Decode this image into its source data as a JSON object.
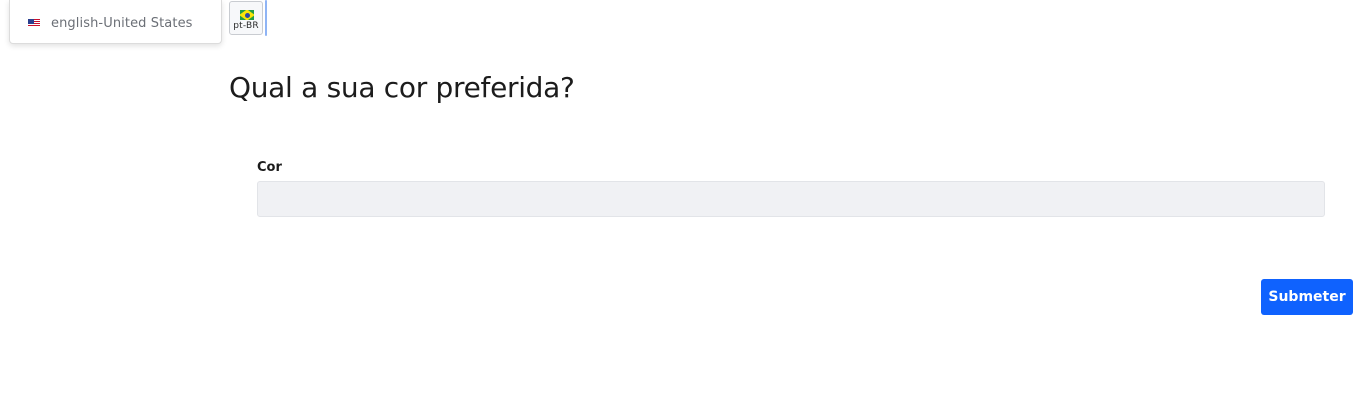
{
  "language_menu": {
    "options": [
      {
        "label": "english-United States",
        "flag_icon": "us-flag-icon"
      }
    ]
  },
  "language_selector": {
    "current_code": "pt-BR",
    "flag_icon": "brazil-flag-icon"
  },
  "question": {
    "title": "Qual a sua cor preferida?"
  },
  "field": {
    "label": "Cor",
    "value": "",
    "placeholder": ""
  },
  "actions": {
    "submit_label": "Submeter"
  },
  "colors": {
    "primary": "#0f62fe",
    "input_background": "#f0f1f4",
    "muted_text": "#6b6f76"
  }
}
